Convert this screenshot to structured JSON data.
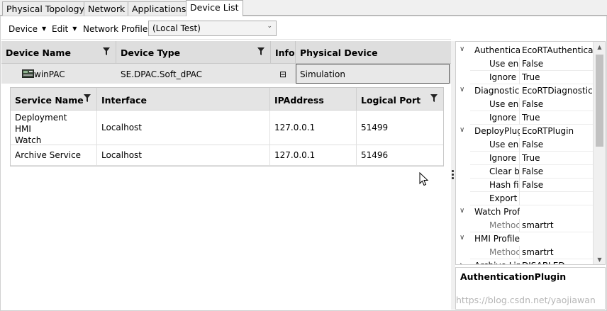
{
  "tabs": [
    {
      "label": "Physical Topology"
    },
    {
      "label": "Network"
    },
    {
      "label": "Applications"
    },
    {
      "label": "Device List"
    }
  ],
  "toolbar": {
    "device_menu": "Device",
    "edit_menu": "Edit",
    "network_profile_label": "Network Profile :",
    "network_profile_value": "(Local Test)"
  },
  "device_grid": {
    "columns": [
      "Device Name",
      "Device Type",
      "Info",
      "Physical Device"
    ],
    "rows": [
      {
        "name": "winPAC",
        "type": "SE.DPAC.Soft_dPAC",
        "info": "⊟",
        "physical": "Simulation"
      }
    ]
  },
  "services": {
    "columns": [
      "Service Name",
      "Interface",
      "IPAddress",
      "Logical Port"
    ],
    "rows": [
      {
        "name_lines": [
          "Deployment",
          "HMI",
          "Watch"
        ],
        "interface": "Localhost",
        "ip": "127.0.0.1",
        "port": "51499"
      },
      {
        "name_lines": [
          "Archive Service"
        ],
        "interface": "Localhost",
        "ip": "127.0.0.1",
        "port": "51496"
      }
    ]
  },
  "properties": [
    {
      "group": true,
      "name": "Authenticat",
      "value": "EcoRTAuthenticat"
    },
    {
      "group": false,
      "name": "Use en",
      "value": "False"
    },
    {
      "group": false,
      "name": "Ignore",
      "value": "True"
    },
    {
      "group": true,
      "name": "Diagnosticl",
      "value": "EcoRTDiagnosticl"
    },
    {
      "group": false,
      "name": "Use en",
      "value": "False"
    },
    {
      "group": false,
      "name": "Ignore",
      "value": "True"
    },
    {
      "group": true,
      "name": "DeployPlug",
      "value": "EcoRTPlugin"
    },
    {
      "group": false,
      "name": "Use en",
      "value": "False"
    },
    {
      "group": false,
      "name": "Ignore",
      "value": "True"
    },
    {
      "group": false,
      "name": "Clear b",
      "value": "False"
    },
    {
      "group": false,
      "name": "Hash fil",
      "value": "False"
    },
    {
      "group": false,
      "name": "Export",
      "value": ""
    },
    {
      "group": true,
      "name": "Watch Prof",
      "value": ""
    },
    {
      "group": false,
      "name": "Methoc",
      "value": "smartrt",
      "dim": true
    },
    {
      "group": true,
      "name": "HMI Profile",
      "value": ""
    },
    {
      "group": false,
      "name": "Methoc",
      "value": "smartrt",
      "dim": true
    },
    {
      "group": true,
      "name": "Archive Lin",
      "value": "DISABLED",
      "collapsed": true
    }
  ],
  "description_panel": {
    "title": "AuthenticationPlugin",
    "watermark": "https://blog.csdn.net/yaojiawan"
  },
  "colors": {
    "header_bg": "#dedede",
    "selected_row_bg": "#e6e6e6",
    "border": "#adadad"
  }
}
